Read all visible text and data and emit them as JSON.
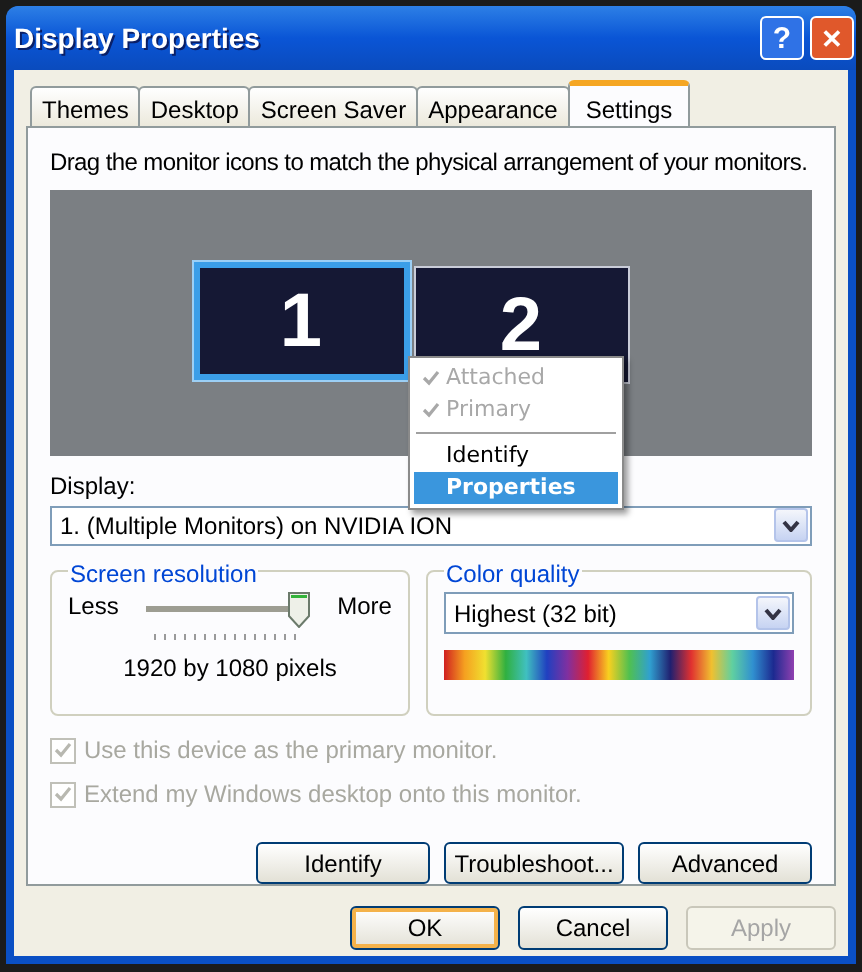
{
  "window": {
    "title": "Display Properties",
    "help_label": "?",
    "close_label": "✕"
  },
  "tabs": [
    {
      "label": "Themes",
      "selected": false
    },
    {
      "label": "Desktop",
      "selected": false
    },
    {
      "label": "Screen Saver",
      "selected": false
    },
    {
      "label": "Appearance",
      "selected": false
    },
    {
      "label": "Settings",
      "selected": true
    }
  ],
  "instruction": "Drag the monitor icons to match the physical arrangement of your monitors.",
  "monitors": [
    {
      "label": "1",
      "selected": true
    },
    {
      "label": "2",
      "selected": false
    }
  ],
  "context_menu": [
    {
      "kind": "item",
      "label": "Attached",
      "checked": true,
      "disabled": true,
      "selected": false
    },
    {
      "kind": "item",
      "label": "Primary",
      "checked": true,
      "disabled": true,
      "selected": false
    },
    {
      "kind": "separator"
    },
    {
      "kind": "item",
      "label": "Identify",
      "checked": false,
      "disabled": false,
      "selected": false
    },
    {
      "kind": "item",
      "label": "Properties",
      "checked": false,
      "disabled": false,
      "selected": true
    }
  ],
  "display": {
    "label": "Display:",
    "value": "1. (Multiple Monitors) on NVIDIA ION"
  },
  "screen_resolution": {
    "title": "Screen resolution",
    "less": "Less",
    "more": "More",
    "level": 1,
    "reading": "1920 by 1080 pixels"
  },
  "color_quality": {
    "title": "Color quality",
    "value": "Highest (32 bit)"
  },
  "checkboxes": [
    {
      "label": "Use this device as the primary monitor.",
      "checked": true,
      "disabled": true
    },
    {
      "label": "Extend my Windows desktop onto this monitor.",
      "checked": true,
      "disabled": true
    }
  ],
  "panel_buttons": [
    {
      "label": "Identify"
    },
    {
      "label": "Troubleshoot..."
    },
    {
      "label": "Advanced"
    }
  ],
  "dialog_buttons": [
    {
      "label": "OK",
      "default": true,
      "disabled": false
    },
    {
      "label": "Cancel",
      "default": false,
      "disabled": false
    },
    {
      "label": "Apply",
      "default": false,
      "disabled": true
    }
  ]
}
